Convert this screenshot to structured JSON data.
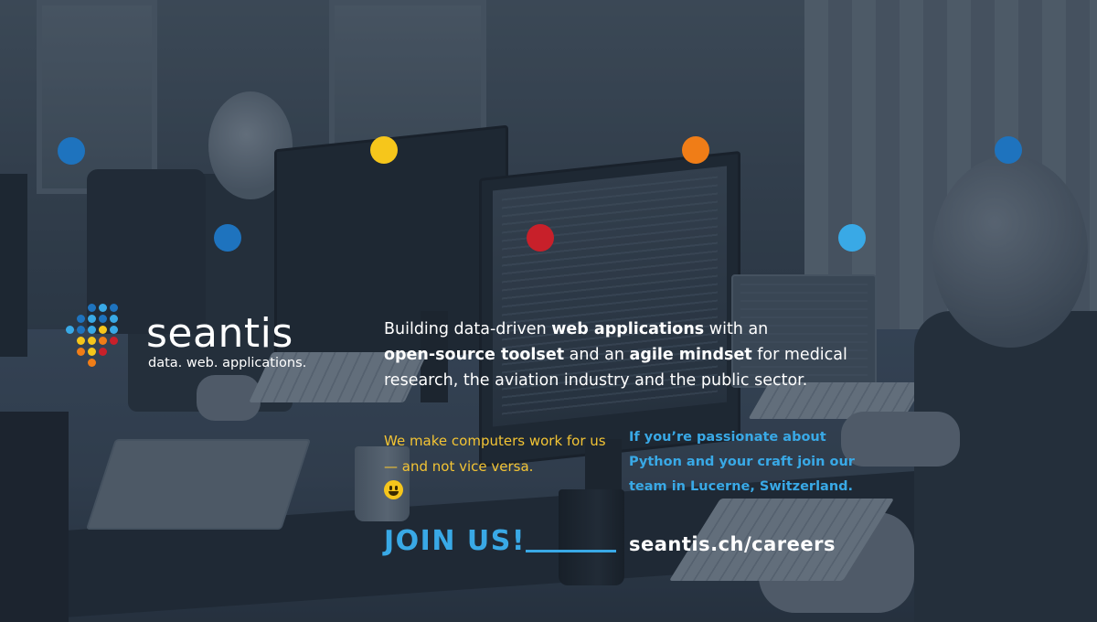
{
  "brand": {
    "name": "seantis",
    "tagline": "data. web. applications."
  },
  "intro": {
    "part1": "Building data-driven ",
    "bold1": "web applications",
    "part2": " with an ",
    "bold2": "open-source toolset",
    "part3": " and an ",
    "bold3": "agile mindset",
    "part4": " for medical research, the aviation industry and the public sector."
  },
  "left_note": {
    "text": "We make computers work for us — and not vice versa.",
    "emoji": "grinning-face"
  },
  "right_note": {
    "text": "If you’re passionate about Python and your craft join our team in Lucerne, Switzerland."
  },
  "cta": {
    "join_label": "JOIN US!",
    "url": "seantis.ch/careers"
  },
  "colors": {
    "blue": "#1e73be",
    "light_blue": "#39a9e6",
    "yellow": "#f6c61b",
    "orange": "#f07d17",
    "red": "#c8202a",
    "text_yellow": "#f3c434"
  }
}
